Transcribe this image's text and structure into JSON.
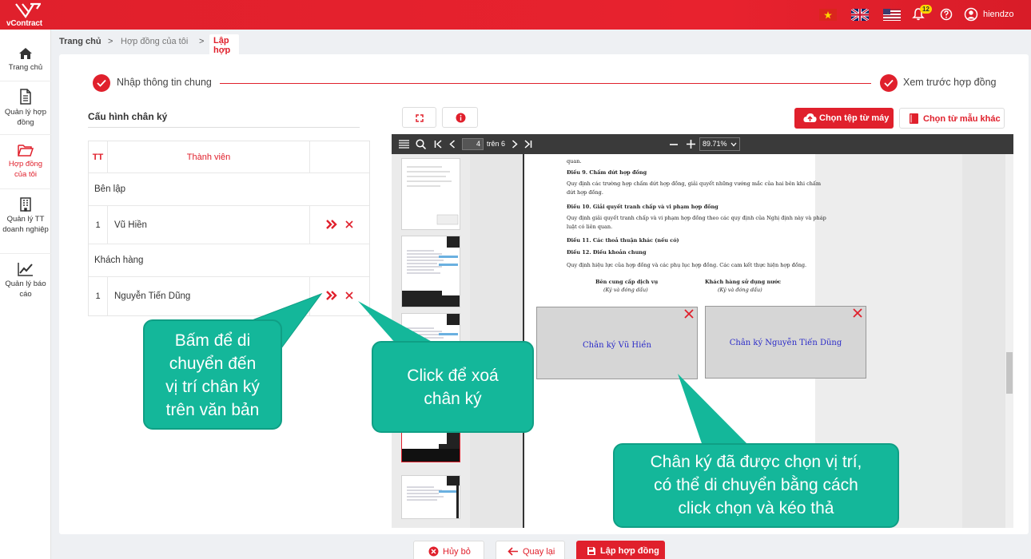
{
  "app": {
    "logo_text": "vContract",
    "username": "hiendzo",
    "notification_count": "12"
  },
  "sidebar": {
    "items": [
      {
        "label": "Trang chủ",
        "icon": "home-icon"
      },
      {
        "label": "Quản lý hợp đồng",
        "icon": "document-icon"
      },
      {
        "label": "Hợp đồng của tôi",
        "icon": "folder-icon",
        "active": true
      },
      {
        "label": "Quản lý TT doanh nghiệp",
        "icon": "building-icon"
      },
      {
        "label": "Quản lý báo cáo",
        "icon": "chart-icon"
      }
    ]
  },
  "breadcrumb": {
    "items": [
      "Trang chủ",
      "Hợp đồng của tôi",
      "Lập hợp đồng"
    ],
    "separator": ">"
  },
  "steps": [
    {
      "label": "Nhập thông tin chung"
    },
    {
      "label": "Xem trước hợp đồng"
    }
  ],
  "signature_config": {
    "title": "Cấu hình chân ký",
    "columns": {
      "no": "TT",
      "member": "Thành viên"
    },
    "groups": [
      {
        "name": "Bên lập",
        "members": [
          {
            "no": "1",
            "name": "Vũ Hiền"
          }
        ]
      },
      {
        "name": "Khách hàng",
        "members": [
          {
            "no": "1",
            "name": "Nguyễn Tiến Dũng"
          }
        ]
      }
    ]
  },
  "toolbar": {
    "upload_label": "Chọn tệp từ máy",
    "template_label": "Chọn từ mẫu khác"
  },
  "viewer": {
    "page": "4",
    "page_total": "trên 6",
    "zoom": "89.71%"
  },
  "document": {
    "lines": [
      {
        "text": "quan.",
        "bold": false
      },
      {
        "text": "Điều 9. Chấm dứt hợp đồng",
        "bold": true
      },
      {
        "text": "Quy định các trường hợp chấm dứt hợp đồng, giải quyết những vướng mắc của hai bên khi chấm",
        "bold": false
      },
      {
        "text": "dứt hợp đồng.",
        "bold": false
      },
      {
        "text": "Điều 10. Giải quyết tranh chấp và vi phạm hợp đồng",
        "bold": true
      },
      {
        "text": "Quy định giải quyết tranh chấp và vi phạm hợp đồng theo các quy định của Nghị định này và pháp",
        "bold": false
      },
      {
        "text": "luật có liên quan.",
        "bold": false
      },
      {
        "text": "Điều 11. Các thoả thuận khác (nếu có)",
        "bold": true
      },
      {
        "text": "Điều 12. Điều khoản chung",
        "bold": true
      },
      {
        "text": "Quy định hiệu lực của hợp đồng và các phụ lục hợp đồng. Các cam kết thực hiện hợp đồng.",
        "bold": false
      }
    ],
    "party_a": "Bên cung cấp dịch vụ",
    "party_b": "Khách hàng sử dụng nước",
    "sign_note": "(Ký và đóng dấu)",
    "signatures": [
      "Chân ký Vũ Hiền",
      "Chân ký Nguyễn Tiến Dũng"
    ]
  },
  "callouts": {
    "move": [
      "Bấm để di",
      "chuyển đến",
      "vị trí chân ký",
      "trên văn bản"
    ],
    "delete": [
      "Click để xoá",
      "chân ký"
    ],
    "placed": [
      "Chân ký đã được chọn vị trí,",
      "có thể di chuyển bằng cách",
      "click chọn và kéo thả"
    ]
  },
  "footer": {
    "cancel": "Hủy bỏ",
    "back": "Quay lại",
    "create": "Lập hợp đồng"
  },
  "colors": {
    "brand": "#e0202c",
    "callout": "#14b79a",
    "signature_text": "#2a2ac8"
  }
}
